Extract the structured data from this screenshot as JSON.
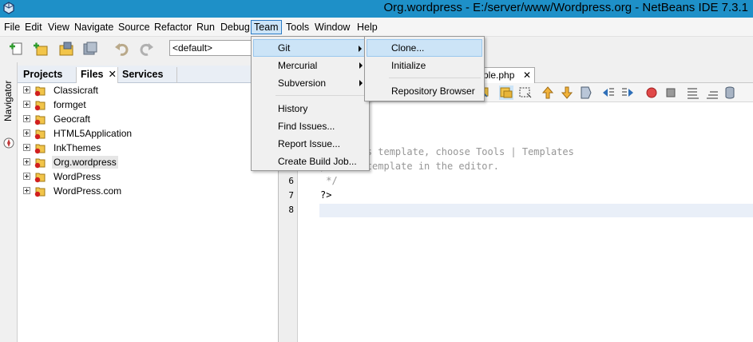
{
  "window": {
    "title": "Org.wordpress - E:/server/www/Wordpress.org - NetBeans IDE 7.3.1"
  },
  "menubar": {
    "items": [
      "File",
      "Edit",
      "View",
      "Navigate",
      "Source",
      "Refactor",
      "Run",
      "Debug",
      "Team",
      "Tools",
      "Window",
      "Help"
    ],
    "active": "Team"
  },
  "toolbar": {
    "config_value": "<default>"
  },
  "navigator": {
    "label": "Navigator"
  },
  "projects_panel": {
    "tabs": [
      {
        "label": "Projects"
      },
      {
        "label": "Files",
        "close": "✕"
      },
      {
        "label": "Services"
      }
    ],
    "tree": [
      "Classicraft",
      "formget",
      "Geocraft",
      "HTML5Application",
      "InkThemes",
      "Org.wordpress",
      "WordPress",
      "WordPress.com"
    ],
    "selected": "Org.wordpress"
  },
  "editor": {
    "tab_label": "ple.php",
    "tab_close": "✕",
    "lines": [
      {
        "num": "",
        "text": "ange this template, choose Tools | Templates",
        "kind": "comment"
      },
      {
        "num": "",
        "text": "pen the template in the editor.",
        "kind": "comment"
      },
      {
        "num": "6",
        "text": " */",
        "kind": "comment"
      },
      {
        "num": "7",
        "text": "?>",
        "kind": "code"
      },
      {
        "num": "8",
        "text": "",
        "kind": "code"
      }
    ]
  },
  "team_menu": {
    "items": [
      "Git",
      "Mercurial",
      "Subversion",
      "History",
      "Find Issues...",
      "Report Issue...",
      "Create Build Job..."
    ],
    "highlighted": "Git"
  },
  "git_submenu": {
    "items": [
      "Clone...",
      "Initialize",
      "Repository Browser"
    ],
    "highlighted": "Clone..."
  },
  "colors": {
    "titlebar": "#1e90c8",
    "menu_highlight": "#cce4f7",
    "menu_highlight_border": "#2b7bc5"
  }
}
